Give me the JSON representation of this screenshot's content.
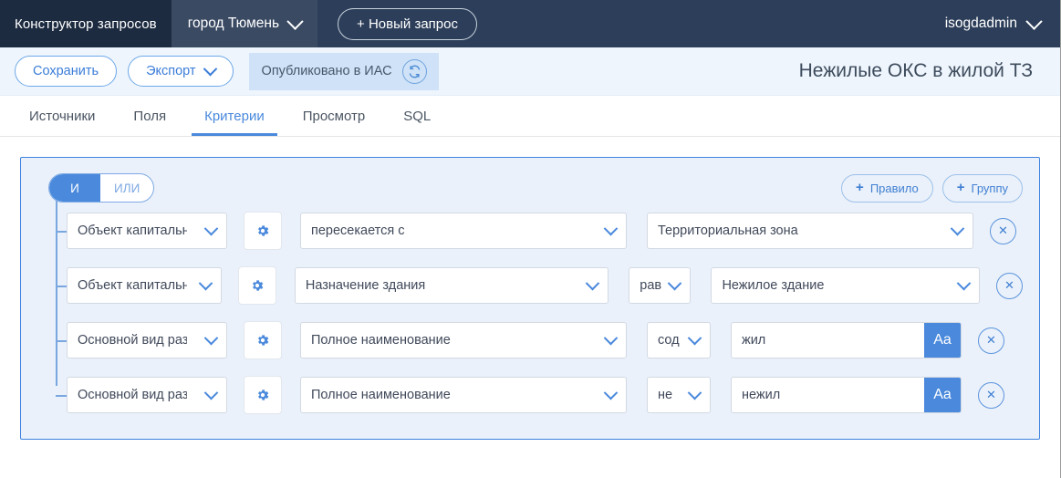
{
  "topbar": {
    "brand": "Конструктор запросов",
    "project": "город Тюмень",
    "new_query": "+ Новый запрос",
    "user": "isogdadmin"
  },
  "toolbar": {
    "save_label": "Сохранить",
    "export_label": "Экспорт",
    "publish_status": "Опубликовано в ИАС",
    "doc_title": "Нежилые ОКС в жилой ТЗ"
  },
  "tabs": [
    {
      "label": "Источники",
      "active": false
    },
    {
      "label": "Поля",
      "active": false
    },
    {
      "label": "Критерии",
      "active": true
    },
    {
      "label": "Просмотр",
      "active": false
    },
    {
      "label": "SQL",
      "active": false
    }
  ],
  "criteria": {
    "logic": {
      "and_label": "И",
      "or_label": "ИЛИ",
      "selected": "И"
    },
    "add_rule_label": "Правило",
    "add_group_label": "Группу",
    "plus": "+",
    "close_glyph": "✕",
    "rules": [
      {
        "source": "Объект капитально",
        "field": "пересекается с",
        "operator": null,
        "value": "Территориальная зона",
        "value_kind": "select"
      },
      {
        "source": "Объект капитально",
        "field": "Назначение здания",
        "operator": "рав",
        "value": "Нежилое здание",
        "value_kind": "select"
      },
      {
        "source": "Основной вид раз",
        "field": "Полное наименование",
        "operator": "сод",
        "value": "жил",
        "value_kind": "text",
        "case_label": "Aa"
      },
      {
        "source": "Основной вид раз",
        "field": "Полное наименование",
        "operator": "не",
        "value": "нежил",
        "value_kind": "text",
        "case_label": "Aa"
      }
    ]
  },
  "colors": {
    "accent": "#4a89dc",
    "panel_border": "#3f83df",
    "panel_bg": "#eaf1fa",
    "topbar_bg": "#2c3e59"
  }
}
